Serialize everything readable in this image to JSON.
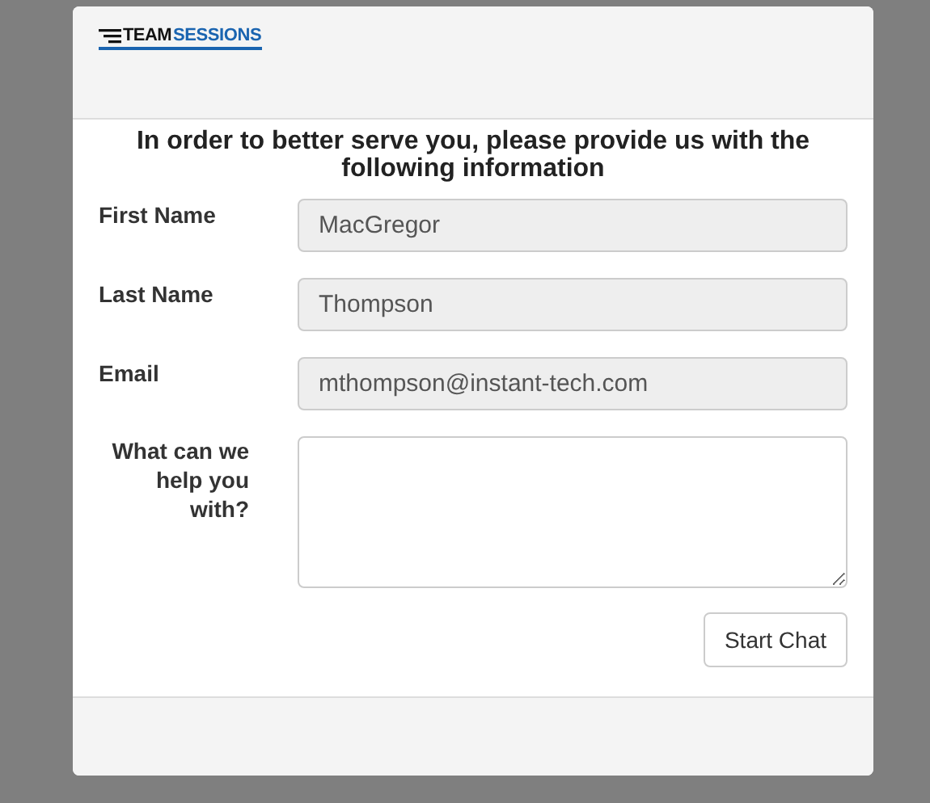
{
  "logo": {
    "part_1": "TEAM",
    "part_2": "SESSIONS"
  },
  "heading": "In order to better serve you, please provide us with the following information",
  "fields": [
    {
      "kind": "input",
      "label": "First Name",
      "value": "MacGregor",
      "disabled": true
    },
    {
      "kind": "input",
      "label": "Last Name",
      "value": "Thompson",
      "disabled": true
    },
    {
      "kind": "input",
      "label": "Email",
      "value": "mthompson@instant-tech.com",
      "disabled": true
    },
    {
      "kind": "textarea",
      "label": "What can we help you with?",
      "disabled": false
    }
  ],
  "button": "Start Chat"
}
